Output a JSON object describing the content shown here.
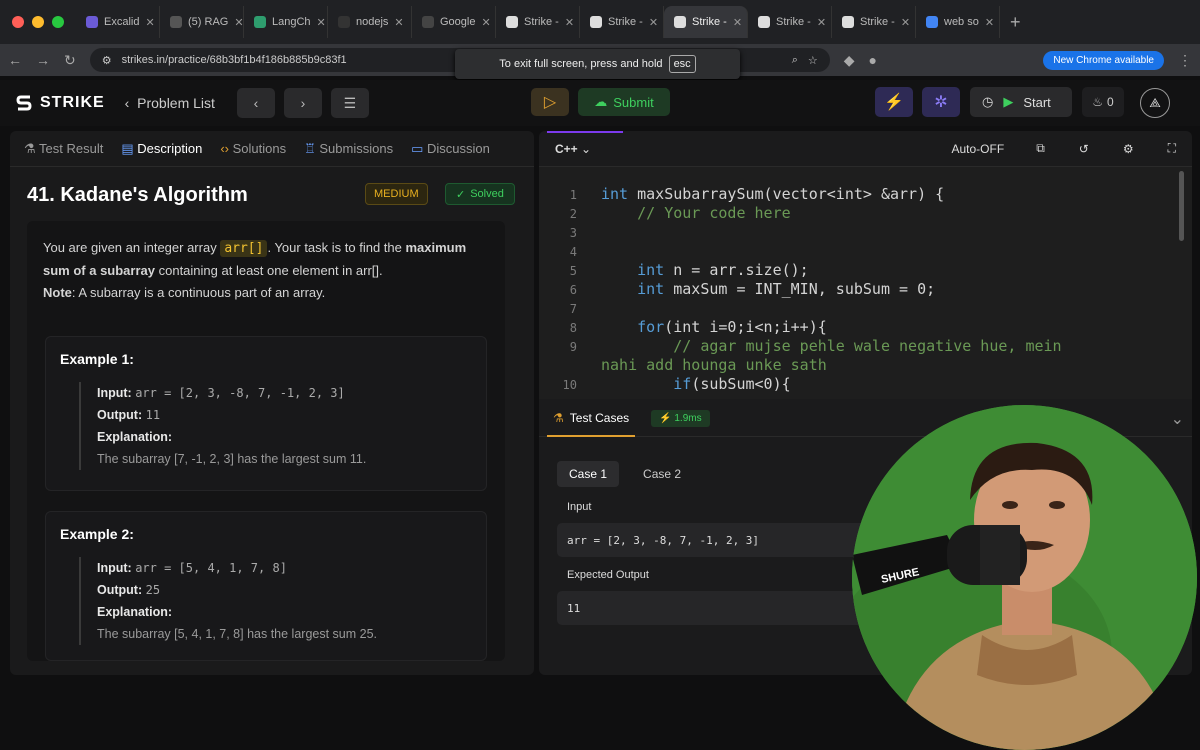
{
  "browser": {
    "tabs": [
      {
        "label": "Excalid",
        "fav": "#6b5bd6"
      },
      {
        "label": "(5) RAG",
        "fav": "#555"
      },
      {
        "label": "LangCh",
        "fav": "#2e9d6e"
      },
      {
        "label": "nodejs",
        "fav": "#333"
      },
      {
        "label": "Google",
        "fav": "#444"
      },
      {
        "label": "Strike -",
        "fav": "#ddd"
      },
      {
        "label": "Strike -",
        "fav": "#ddd"
      },
      {
        "label": "Strike -",
        "fav": "#ddd"
      },
      {
        "label": "Strike -",
        "fav": "#ddd"
      },
      {
        "label": "Strike -",
        "fav": "#ddd"
      },
      {
        "label": "web so",
        "fav": "#4285f4"
      }
    ],
    "url": "strikes.in/practice/68b3bf1b4f186b885b9c83f1",
    "new_chrome": "New Chrome available",
    "fullscreen_notice": "To exit full screen, press and hold",
    "esc_key": "esc"
  },
  "app": {
    "logo_text": "STRIKE",
    "problem_list": "Problem List",
    "submit": "Submit",
    "start": "Start",
    "streak": "0"
  },
  "problem": {
    "tabs": [
      "Test Result",
      "Description",
      "Solutions",
      "Submissions",
      "Discussion"
    ],
    "title": "41. Kadane's Algorithm",
    "difficulty": "MEDIUM",
    "status": "Solved",
    "desc_1": "You are given an integer array ",
    "desc_code": "arr[]",
    "desc_2": ". Your task is to find the ",
    "desc_bold": "maximum sum of a subarray",
    "desc_3": " containing at least one element in arr[].",
    "note_label": "Note",
    "note_text": ": A subarray is a continuous part of an array.",
    "examples": [
      {
        "title": "Example 1:",
        "input_label": "Input:",
        "input": "arr = [2, 3, -8, 7, -1, 2, 3]",
        "output_label": "Output:",
        "output": "11",
        "expl_label": "Explanation:",
        "expl": "The subarray [7, -1, 2, 3] has the largest sum 11."
      },
      {
        "title": "Example 2:",
        "input_label": "Input:",
        "input": "arr = [5, 4, 1, 7, 8]",
        "output_label": "Output:",
        "output": "25",
        "expl_label": "Explanation:",
        "expl": "The subarray [5, 4, 1, 7, 8] has the largest sum 25."
      }
    ]
  },
  "editor": {
    "language": "C++",
    "autosave": "Auto-OFF",
    "lines": [
      {
        "n": "1",
        "kw": "int",
        "text": " maxSubarraySum(vector<int> &arr) {"
      },
      {
        "n": "2",
        "cm": "    // Your code here"
      },
      {
        "n": "3",
        "text": ""
      },
      {
        "n": "4",
        "text": ""
      },
      {
        "n": "5",
        "kw": "    int",
        "text": " n = arr.size();"
      },
      {
        "n": "6",
        "kw": "    int",
        "text": " maxSum = INT_MIN, subSum = 0;"
      },
      {
        "n": "7",
        "text": ""
      },
      {
        "n": "8",
        "kw": "    for",
        "text": "(int i=0;i<n;i++){"
      },
      {
        "n": "9",
        "cm": "        // agar mujse pehle wale negative hue, mein"
      },
      {
        "n": "",
        "cm": "nahi add hounga unke sath"
      },
      {
        "n": "10",
        "kw": "        if",
        "text": "(subSum<0){"
      }
    ]
  },
  "tests": {
    "header": "Test Cases",
    "time": "1.9ms",
    "cases": [
      "Case 1",
      "Case 2"
    ],
    "input_label": "Input",
    "input_value": "arr = [2, 3, -8, 7, -1, 2, 3]",
    "expected_label": "Expected Output",
    "expected_value": "11"
  },
  "webcam": {
    "mic_text": "SHURE"
  }
}
